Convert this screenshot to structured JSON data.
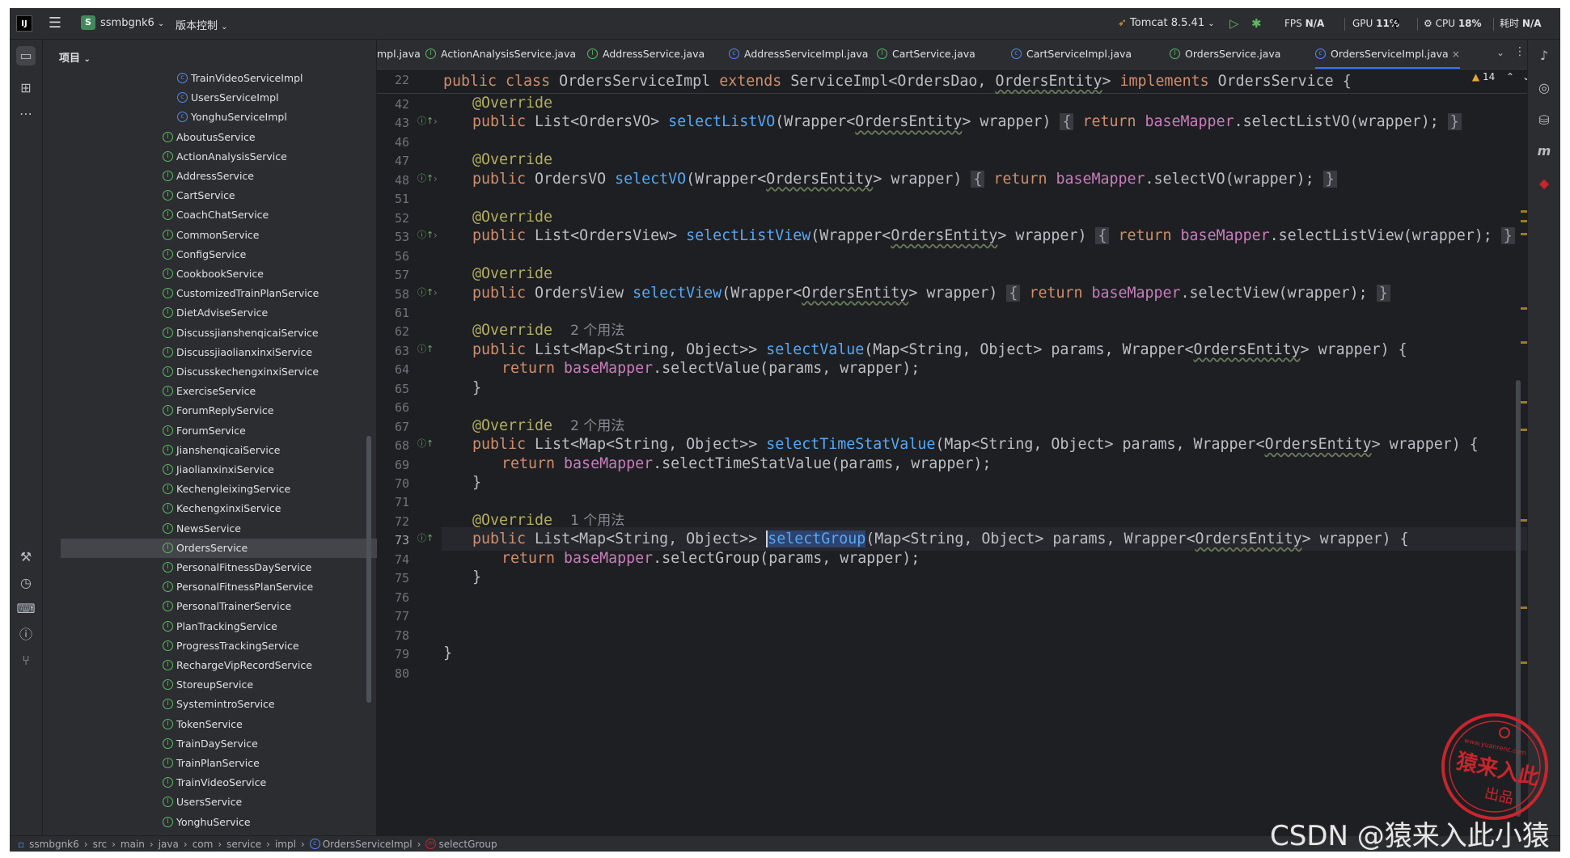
{
  "topbar": {
    "logo": "IJ",
    "project_badge": "S",
    "project_name": "ssmbgnk6",
    "vcs_label": "版本控制",
    "run_config": "Tomcat 8.5.41",
    "fps_label": "FPS",
    "fps_value": "N/A",
    "gpu_label": "GPU",
    "gpu_value": "11%",
    "cpu_label": "CPU",
    "cpu_value": "18%",
    "time_label": "耗时",
    "time_value": "N/A"
  },
  "project_panel": {
    "title": "项目",
    "items": [
      {
        "label": "TrainVideoServiceImpl",
        "kind": "class"
      },
      {
        "label": "UsersServiceImpl",
        "kind": "class"
      },
      {
        "label": "YonghuServiceImpl",
        "kind": "class"
      },
      {
        "label": "AboutusService",
        "kind": "iface"
      },
      {
        "label": "ActionAnalysisService",
        "kind": "iface"
      },
      {
        "label": "AddressService",
        "kind": "iface"
      },
      {
        "label": "CartService",
        "kind": "iface"
      },
      {
        "label": "CoachChatService",
        "kind": "iface"
      },
      {
        "label": "CommonService",
        "kind": "iface"
      },
      {
        "label": "ConfigService",
        "kind": "iface"
      },
      {
        "label": "CookbookService",
        "kind": "iface"
      },
      {
        "label": "CustomizedTrainPlanService",
        "kind": "iface"
      },
      {
        "label": "DietAdviseService",
        "kind": "iface"
      },
      {
        "label": "DiscussjianshenqicaiService",
        "kind": "iface"
      },
      {
        "label": "DiscussjiaolianxinxiService",
        "kind": "iface"
      },
      {
        "label": "DiscusskechengxinxiService",
        "kind": "iface"
      },
      {
        "label": "ExerciseService",
        "kind": "iface"
      },
      {
        "label": "ForumReplyService",
        "kind": "iface"
      },
      {
        "label": "ForumService",
        "kind": "iface"
      },
      {
        "label": "JianshenqicaiService",
        "kind": "iface"
      },
      {
        "label": "JiaolianxinxiService",
        "kind": "iface"
      },
      {
        "label": "KechengleixingService",
        "kind": "iface"
      },
      {
        "label": "KechengxinxiService",
        "kind": "iface"
      },
      {
        "label": "NewsService",
        "kind": "iface"
      },
      {
        "label": "OrdersService",
        "kind": "iface",
        "selected": true
      },
      {
        "label": "PersonalFitnessDayService",
        "kind": "iface"
      },
      {
        "label": "PersonalFitnessPlanService",
        "kind": "iface"
      },
      {
        "label": "PersonalTrainerService",
        "kind": "iface"
      },
      {
        "label": "PlanTrackingService",
        "kind": "iface"
      },
      {
        "label": "ProgressTrackingService",
        "kind": "iface"
      },
      {
        "label": "RechargeVipRecordService",
        "kind": "iface"
      },
      {
        "label": "StoreupService",
        "kind": "iface"
      },
      {
        "label": "SystemintroService",
        "kind": "iface"
      },
      {
        "label": "TokenService",
        "kind": "iface"
      },
      {
        "label": "TrainDayService",
        "kind": "iface"
      },
      {
        "label": "TrainPlanService",
        "kind": "iface"
      },
      {
        "label": "TrainVideoService",
        "kind": "iface"
      },
      {
        "label": "UsersService",
        "kind": "iface"
      },
      {
        "label": "YonghuService",
        "kind": "iface"
      }
    ]
  },
  "tabs": [
    {
      "label": "mpl.java",
      "kind": "none"
    },
    {
      "label": "ActionAnalysisService.java",
      "kind": "iface"
    },
    {
      "label": "AddressService.java",
      "kind": "iface"
    },
    {
      "label": "AddressServiceImpl.java",
      "kind": "class"
    },
    {
      "label": "CartService.java",
      "kind": "iface"
    },
    {
      "label": "CartServiceImpl.java",
      "kind": "class"
    },
    {
      "label": "OrdersService.java",
      "kind": "iface"
    },
    {
      "label": "OrdersServiceImpl.java",
      "kind": "class",
      "active": true
    }
  ],
  "editor": {
    "warning_count": "14",
    "sticky_line_number": "22",
    "sticky": [
      {
        "t": "public class ",
        "c": "kw"
      },
      {
        "t": "OrdersServiceImpl "
      },
      {
        "t": "extends ",
        "c": "kw"
      },
      {
        "t": "ServiceImpl<OrdersDao, "
      },
      {
        "t": "OrdersEntity",
        "c": "ul"
      },
      {
        "t": "> "
      },
      {
        "t": "implements ",
        "c": "kw"
      },
      {
        "t": "OrdersService {"
      }
    ],
    "lines": [
      {
        "n": "42",
        "indent": 1,
        "tokens": [
          {
            "t": "@Override",
            "c": "ann"
          }
        ]
      },
      {
        "n": "43",
        "indent": 1,
        "gi": true,
        "fold": true,
        "tokens": [
          {
            "t": "public ",
            "c": "kw"
          },
          {
            "t": "List<OrdersVO> "
          },
          {
            "t": "selectListVO",
            "c": "fn"
          },
          {
            "t": "(Wrapper<"
          },
          {
            "t": "OrdersEntity",
            "c": "ul"
          },
          {
            "t": "> wrapper) "
          },
          {
            "t": "{",
            "c": "fold-box"
          },
          {
            "t": " "
          },
          {
            "t": "return ",
            "c": "kw"
          },
          {
            "t": "baseMapper",
            "c": "fld"
          },
          {
            "t": ".selectListVO(wrapper); "
          },
          {
            "t": "}",
            "c": "fold-box"
          }
        ]
      },
      {
        "n": "46",
        "indent": 0,
        "tokens": []
      },
      {
        "n": "47",
        "indent": 1,
        "tokens": [
          {
            "t": "@Override",
            "c": "ann"
          }
        ]
      },
      {
        "n": "48",
        "indent": 1,
        "gi": true,
        "fold": true,
        "tokens": [
          {
            "t": "public ",
            "c": "kw"
          },
          {
            "t": "OrdersVO "
          },
          {
            "t": "selectVO",
            "c": "fn"
          },
          {
            "t": "(Wrapper<"
          },
          {
            "t": "OrdersEntity",
            "c": "ul"
          },
          {
            "t": "> wrapper) "
          },
          {
            "t": "{",
            "c": "fold-box"
          },
          {
            "t": " "
          },
          {
            "t": "return ",
            "c": "kw"
          },
          {
            "t": "baseMapper",
            "c": "fld"
          },
          {
            "t": ".selectVO(wrapper); "
          },
          {
            "t": "}",
            "c": "fold-box"
          }
        ]
      },
      {
        "n": "51",
        "indent": 0,
        "tokens": []
      },
      {
        "n": "52",
        "indent": 1,
        "tokens": [
          {
            "t": "@Override",
            "c": "ann"
          }
        ]
      },
      {
        "n": "53",
        "indent": 1,
        "gi": true,
        "fold": true,
        "tokens": [
          {
            "t": "public ",
            "c": "kw"
          },
          {
            "t": "List<OrdersView> "
          },
          {
            "t": "selectListView",
            "c": "fn"
          },
          {
            "t": "(Wrapper<"
          },
          {
            "t": "OrdersEntity",
            "c": "ul"
          },
          {
            "t": "> wrapper) "
          },
          {
            "t": "{",
            "c": "fold-box"
          },
          {
            "t": " "
          },
          {
            "t": "return ",
            "c": "kw"
          },
          {
            "t": "baseMapper",
            "c": "fld"
          },
          {
            "t": ".selectListView(wrapper); "
          },
          {
            "t": "}",
            "c": "fold-box"
          }
        ]
      },
      {
        "n": "56",
        "indent": 0,
        "tokens": []
      },
      {
        "n": "57",
        "indent": 1,
        "tokens": [
          {
            "t": "@Override",
            "c": "ann"
          }
        ]
      },
      {
        "n": "58",
        "indent": 1,
        "gi": true,
        "fold": true,
        "tokens": [
          {
            "t": "public ",
            "c": "kw"
          },
          {
            "t": "OrdersView "
          },
          {
            "t": "selectView",
            "c": "fn"
          },
          {
            "t": "(Wrapper<"
          },
          {
            "t": "OrdersEntity",
            "c": "ul"
          },
          {
            "t": "> wrapper) "
          },
          {
            "t": "{",
            "c": "fold-box"
          },
          {
            "t": " "
          },
          {
            "t": "return ",
            "c": "kw"
          },
          {
            "t": "baseMapper",
            "c": "fld"
          },
          {
            "t": ".selectView(wrapper); "
          },
          {
            "t": "}",
            "c": "fold-box"
          }
        ]
      },
      {
        "n": "61",
        "indent": 0,
        "tokens": []
      },
      {
        "n": "62",
        "indent": 1,
        "tokens": [
          {
            "t": "@Override",
            "c": "ann"
          },
          {
            "t": "  "
          },
          {
            "t": "2 个用法",
            "c": "hint"
          }
        ]
      },
      {
        "n": "63",
        "indent": 1,
        "gi": true,
        "tokens": [
          {
            "t": "public ",
            "c": "kw"
          },
          {
            "t": "List<Map<String, Object>> "
          },
          {
            "t": "selectValue",
            "c": "fn"
          },
          {
            "t": "(Map<String, Object> params, Wrapper<"
          },
          {
            "t": "OrdersEntity",
            "c": "ul"
          },
          {
            "t": "> wrapper) {"
          }
        ]
      },
      {
        "n": "64",
        "indent": 2,
        "tokens": [
          {
            "t": "return ",
            "c": "kw"
          },
          {
            "t": "baseMapper",
            "c": "fld"
          },
          {
            "t": ".selectValue(params, wrapper);"
          }
        ]
      },
      {
        "n": "65",
        "indent": 1,
        "tokens": [
          {
            "t": "}"
          }
        ]
      },
      {
        "n": "66",
        "indent": 0,
        "tokens": []
      },
      {
        "n": "67",
        "indent": 1,
        "tokens": [
          {
            "t": "@Override",
            "c": "ann"
          },
          {
            "t": "  "
          },
          {
            "t": "2 个用法",
            "c": "hint"
          }
        ]
      },
      {
        "n": "68",
        "indent": 1,
        "gi": true,
        "tokens": [
          {
            "t": "public ",
            "c": "kw"
          },
          {
            "t": "List<Map<String, Object>> "
          },
          {
            "t": "selectTimeStatValue",
            "c": "fn"
          },
          {
            "t": "(Map<String, Object> params, Wrapper<"
          },
          {
            "t": "OrdersEntity",
            "c": "ul"
          },
          {
            "t": "> wrapper) {"
          }
        ]
      },
      {
        "n": "69",
        "indent": 2,
        "tokens": [
          {
            "t": "return ",
            "c": "kw"
          },
          {
            "t": "baseMapper",
            "c": "fld"
          },
          {
            "t": ".selectTimeStatValue(params, wrapper);"
          }
        ]
      },
      {
        "n": "70",
        "indent": 1,
        "tokens": [
          {
            "t": "}"
          }
        ]
      },
      {
        "n": "71",
        "indent": 0,
        "tokens": []
      },
      {
        "n": "72",
        "indent": 1,
        "tokens": [
          {
            "t": "@Override",
            "c": "ann"
          },
          {
            "t": "  "
          },
          {
            "t": "1 个用法",
            "c": "hint"
          }
        ]
      },
      {
        "n": "73",
        "indent": 1,
        "gi": true,
        "current": true,
        "tokens": [
          {
            "t": "public ",
            "c": "kw"
          },
          {
            "t": "List<Map<String, Object>> "
          },
          {
            "t": "selectGroup",
            "c": "fn sel-word caret"
          },
          {
            "t": "(Map<String, Object> params, Wrapper<"
          },
          {
            "t": "OrdersEntity",
            "c": "ul"
          },
          {
            "t": "> wrapper) {"
          }
        ]
      },
      {
        "n": "74",
        "indent": 2,
        "tokens": [
          {
            "t": "return ",
            "c": "kw"
          },
          {
            "t": "baseMapper",
            "c": "fld"
          },
          {
            "t": ".selectGroup(params, wrapper);"
          }
        ]
      },
      {
        "n": "75",
        "indent": 1,
        "tokens": [
          {
            "t": "}"
          }
        ]
      },
      {
        "n": "76",
        "indent": 0,
        "tokens": []
      },
      {
        "n": "77",
        "indent": 0,
        "tokens": []
      },
      {
        "n": "78",
        "indent": 0,
        "tokens": []
      },
      {
        "n": "79",
        "indent": 0,
        "tokens": [
          {
            "t": "}"
          }
        ]
      },
      {
        "n": "80",
        "indent": 0,
        "tokens": []
      }
    ]
  },
  "statusbar": {
    "crumbs": [
      "ssmbgnk6",
      "src",
      "main",
      "java",
      "com",
      "service",
      "impl",
      "OrdersServiceImpl",
      "selectGroup"
    ],
    "separator": "›"
  },
  "watermark": {
    "stamp_url": "www.yuanrenc.com",
    "stamp_line1": "猿来入此",
    "stamp_line2": "出品",
    "csdn": "CSDN @猿来入此小猿"
  },
  "colors": {
    "background": "#1e1f22",
    "panel": "#2b2d30",
    "keyword": "#cf8e6d",
    "annotation": "#b3ae60",
    "method": "#56a8f5",
    "field": "#c77dbb",
    "accent": "#3574f0",
    "stamp": "#c8252c"
  }
}
